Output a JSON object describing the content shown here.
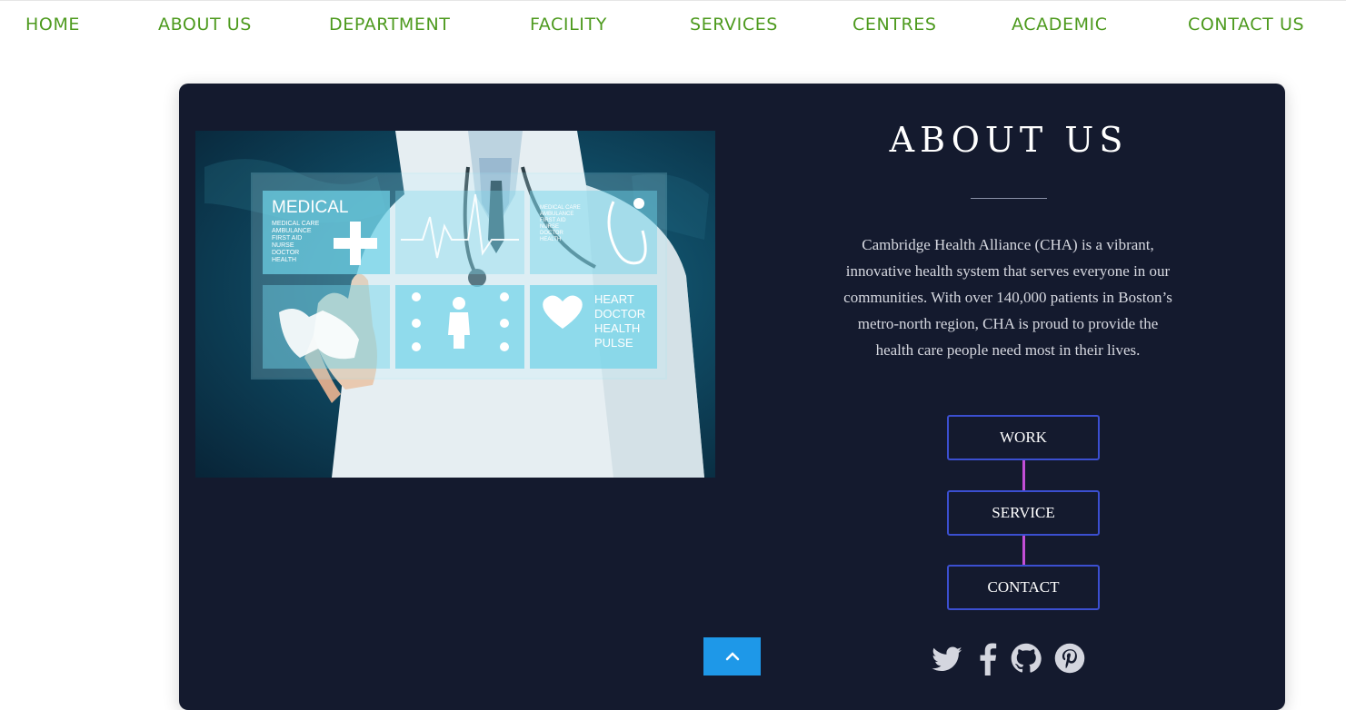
{
  "nav": {
    "items": [
      "HOME",
      "ABOUT US",
      "DEPARTMENT",
      "FACILITY",
      "SERVICES",
      "CENTRES",
      "ACADEMIC",
      "CONTACT US"
    ]
  },
  "about": {
    "title": "ABOUT US",
    "description": "Cambridge Health Alliance (CHA) is a vibrant, innovative health system that serves everyone in our communities. With over 140,000 patients in Boston’s metro-north region, CHA is proud to provide the health care people need most in their lives.",
    "buttons": [
      "WORK",
      "SERVICE",
      "CONTACT"
    ]
  },
  "hero": {
    "panel_medical_title": "MEDICAL",
    "panel_medical_list": [
      "MEDICAL CARE",
      "AMBULANCE",
      "FIRST AID",
      "NURSE",
      "DOCTOR",
      "HEALTH"
    ],
    "panel_small_list": [
      "MEDICAL CARE",
      "AMBULANCE",
      "FIRST AID",
      "NURSE",
      "DOCTOR",
      "HEALTH"
    ],
    "panel_heart_list": [
      "HEART",
      "DOCTOR",
      "HEALTH",
      "PULSE"
    ]
  },
  "social": {
    "icons": [
      "twitter-icon",
      "facebook-icon",
      "github-icon",
      "pinterest-icon"
    ]
  },
  "colors": {
    "nav_text": "#4d9a1e",
    "card_bg": "#141a2e",
    "button_border": "#3b4fd0",
    "connector": "#c24fd6",
    "scroll_top_bg": "#1e98e8"
  }
}
